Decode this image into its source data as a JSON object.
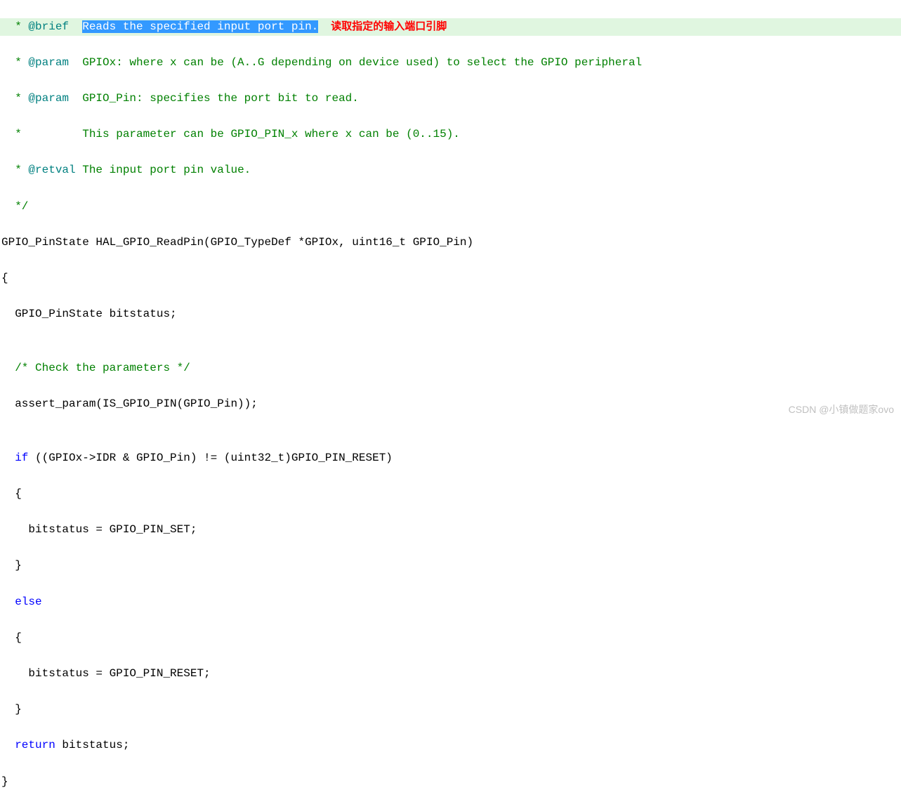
{
  "lines": {
    "l1_prefix": "  * ",
    "l1_tag": "@brief",
    "l1_gap": "  ",
    "l1_brief": "Reads the specified input port pin.",
    "l1_annotation": "读取指定的输入端口引脚",
    "l2_prefix": "  * ",
    "l2_tag": "@param",
    "l2_text": "  GPIOx: where x can be (A..G depending on device used) to select the GPIO peripheral",
    "l3_prefix": "  * ",
    "l3_tag": "@param",
    "l3_text": "  GPIO_Pin: specifies the port bit to read.",
    "l4": "  *         This parameter can be GPIO_PIN_x where x can be (0..15).",
    "l5_prefix": "  * ",
    "l5_tag": "@retval",
    "l5_text": " The input port pin value.",
    "l6": "  */",
    "l7": "GPIO_PinState HAL_GPIO_ReadPin(GPIO_TypeDef *GPIOx, uint16_t GPIO_Pin)",
    "l8": "{",
    "l9": "  GPIO_PinState bitstatus;",
    "l10": "",
    "l11": "  /* Check the parameters */",
    "l12": "  assert_param(IS_GPIO_PIN(GPIO_Pin));",
    "l13": "",
    "l14_a": "  ",
    "l14_if": "if",
    "l14_b": " ((GPIOx->IDR & GPIO_Pin) != (uint32_t)GPIO_PIN_RESET)",
    "l15": "  {",
    "l16": "    bitstatus = GPIO_PIN_SET;",
    "l17": "  }",
    "l18_a": "  ",
    "l18_else": "else",
    "l19": "  {",
    "l20": "    bitstatus = GPIO_PIN_RESET;",
    "l21": "  }",
    "l22_a": "  ",
    "l22_ret": "return",
    "l22_b": " bitstatus;",
    "l23": "}"
  },
  "watermark": "CSDN @小镇做题家ovo"
}
